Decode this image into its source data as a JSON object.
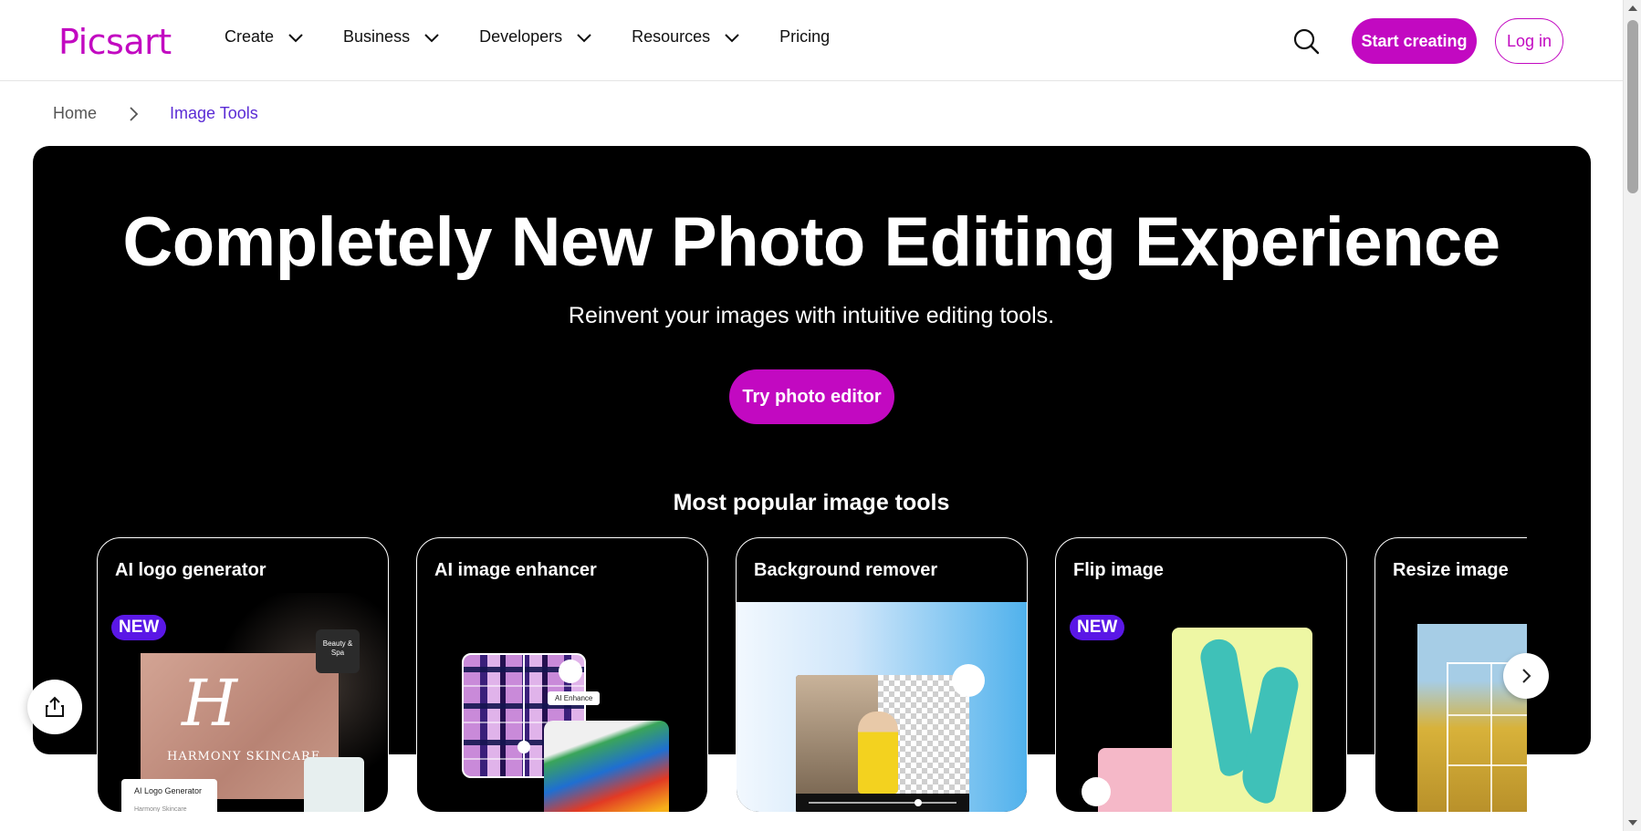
{
  "header": {
    "logo": "Picsart",
    "nav": [
      {
        "label": "Create",
        "has_dropdown": true
      },
      {
        "label": "Business",
        "has_dropdown": true
      },
      {
        "label": "Developers",
        "has_dropdown": true
      },
      {
        "label": "Resources",
        "has_dropdown": true
      },
      {
        "label": "Pricing",
        "has_dropdown": false
      }
    ],
    "search_icon": "search-icon",
    "start_label": "Start creating",
    "login_label": "Log in"
  },
  "breadcrumb": {
    "home": "Home",
    "current": "Image Tools"
  },
  "hero": {
    "title": "Completely New Photo Editing Experience",
    "subtitle": "Reinvent your images with intuitive editing tools.",
    "cta": "Try photo editor",
    "popular_title": "Most popular image tools"
  },
  "cards": [
    {
      "title": "AI logo generator",
      "badge": "NEW"
    },
    {
      "title": "AI image enhancer"
    },
    {
      "title": "Background remover"
    },
    {
      "title": "Flip image",
      "badge": "NEW"
    },
    {
      "title": "Resize image"
    }
  ],
  "card_art": {
    "logo_monogram": "H",
    "logo_brand": "HARMONY SKINCARE",
    "logo_tag": "Beauty & Spa",
    "logo_panel_label": "AI Logo Generator",
    "logo_panel_sub": "Harmony Skincare",
    "enhance_label": "AI Enhance"
  },
  "colors": {
    "brand": "#c209c1",
    "badge": "#5a17e6",
    "breadcrumb_current": "#5a2bd5",
    "hero_bg": "#000000"
  },
  "icons": {
    "next": "chevron-right-icon",
    "share": "share-icon"
  }
}
